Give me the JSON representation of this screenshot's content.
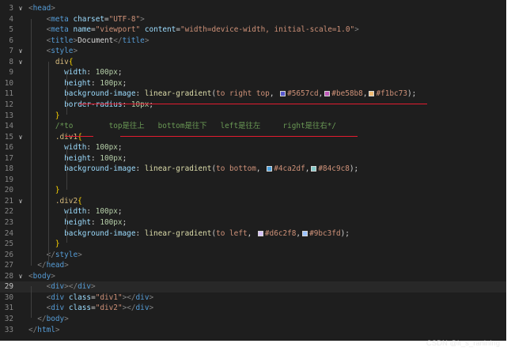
{
  "editor": {
    "lines": [
      {
        "n": "3",
        "fold": "v",
        "segs": [
          [
            "t-br",
            "<"
          ],
          [
            "t-tag",
            "head"
          ],
          [
            "t-br",
            ">"
          ]
        ]
      },
      {
        "n": "4",
        "fold": "",
        "segs": [
          [
            "t-txt",
            "    "
          ],
          [
            "t-br",
            "<"
          ],
          [
            "t-tag",
            "meta"
          ],
          [
            "t-txt",
            " "
          ],
          [
            "t-attr",
            "charset"
          ],
          [
            "t-txt",
            "="
          ],
          [
            "t-str",
            "\"UTF-8\""
          ],
          [
            "t-br",
            ">"
          ]
        ]
      },
      {
        "n": "5",
        "fold": "",
        "segs": [
          [
            "t-txt",
            "    "
          ],
          [
            "t-br",
            "<"
          ],
          [
            "t-tag",
            "meta"
          ],
          [
            "t-txt",
            " "
          ],
          [
            "t-attr",
            "name"
          ],
          [
            "t-txt",
            "="
          ],
          [
            "t-str",
            "\"viewport\""
          ],
          [
            "t-txt",
            " "
          ],
          [
            "t-attr",
            "content"
          ],
          [
            "t-txt",
            "="
          ],
          [
            "t-str",
            "\"width=device-width, initial-scale=1.0\""
          ],
          [
            "t-br",
            ">"
          ]
        ]
      },
      {
        "n": "6",
        "fold": "",
        "segs": [
          [
            "t-txt",
            "    "
          ],
          [
            "t-br",
            "<"
          ],
          [
            "t-tag",
            "title"
          ],
          [
            "t-br",
            ">"
          ],
          [
            "t-txt",
            "Document"
          ],
          [
            "t-br",
            "</"
          ],
          [
            "t-tag",
            "title"
          ],
          [
            "t-br",
            ">"
          ]
        ]
      },
      {
        "n": "7",
        "fold": "v",
        "segs": [
          [
            "t-txt",
            "    "
          ],
          [
            "t-br",
            "<"
          ],
          [
            "t-tag",
            "style"
          ],
          [
            "t-br",
            ">"
          ]
        ]
      },
      {
        "n": "8",
        "fold": "v",
        "segs": [
          [
            "t-txt",
            "      "
          ],
          [
            "t-sel",
            "div"
          ],
          [
            "t-brace",
            "{"
          ]
        ]
      },
      {
        "n": "9",
        "fold": "",
        "segs": [
          [
            "t-txt",
            "        "
          ],
          [
            "t-prop",
            "width"
          ],
          [
            "t-pun",
            ": "
          ],
          [
            "t-num",
            "100px"
          ],
          [
            "t-pun",
            ";"
          ]
        ]
      },
      {
        "n": "10",
        "fold": "",
        "segs": [
          [
            "t-txt",
            "        "
          ],
          [
            "t-prop",
            "height"
          ],
          [
            "t-pun",
            ": "
          ],
          [
            "t-num",
            "100px"
          ],
          [
            "t-pun",
            ";"
          ]
        ]
      },
      {
        "n": "11",
        "fold": "",
        "segs": [
          [
            "t-txt",
            "        "
          ],
          [
            "t-prop",
            "background-image"
          ],
          [
            "t-pun",
            ": "
          ],
          [
            "t-fn",
            "linear-gradient"
          ],
          [
            "t-pun",
            "("
          ],
          [
            "t-val",
            "to right top"
          ],
          [
            "t-pun",
            ", "
          ],
          [
            "sw",
            "#5657cd"
          ],
          [
            "t-val",
            "#5657cd"
          ],
          [
            "t-pun",
            ","
          ],
          [
            "sw",
            "#be58b8"
          ],
          [
            "t-val",
            "#be58b8"
          ],
          [
            "t-pun",
            ","
          ],
          [
            "sw",
            "#f1bc73"
          ],
          [
            "t-val",
            "#f1bc73"
          ],
          [
            "t-pun",
            ");"
          ]
        ]
      },
      {
        "n": "12",
        "fold": "",
        "segs": [
          [
            "t-txt",
            "        "
          ],
          [
            "t-prop",
            "border-radius"
          ],
          [
            "t-pun",
            ": "
          ],
          [
            "t-num",
            "10px"
          ],
          [
            "t-pun",
            ";"
          ]
        ]
      },
      {
        "n": "13",
        "fold": "",
        "segs": [
          [
            "t-txt",
            "      "
          ],
          [
            "t-brace",
            "}"
          ]
        ]
      },
      {
        "n": "14",
        "fold": "",
        "segs": [
          [
            "t-txt",
            "      "
          ],
          [
            "t-cmt",
            "/*to        top是往上   bottom是往下   left是往左     right是往右*/"
          ]
        ]
      },
      {
        "n": "15",
        "fold": "v",
        "segs": [
          [
            "t-txt",
            "      "
          ],
          [
            "t-sel",
            ".div1"
          ],
          [
            "t-brace",
            "{"
          ]
        ]
      },
      {
        "n": "16",
        "fold": "",
        "segs": [
          [
            "t-txt",
            "        "
          ],
          [
            "t-prop",
            "width"
          ],
          [
            "t-pun",
            ": "
          ],
          [
            "t-num",
            "100px"
          ],
          [
            "t-pun",
            ";"
          ]
        ]
      },
      {
        "n": "17",
        "fold": "",
        "segs": [
          [
            "t-txt",
            "        "
          ],
          [
            "t-prop",
            "height"
          ],
          [
            "t-pun",
            ": "
          ],
          [
            "t-num",
            "100px"
          ],
          [
            "t-pun",
            ";"
          ]
        ]
      },
      {
        "n": "18",
        "fold": "",
        "segs": [
          [
            "t-txt",
            "        "
          ],
          [
            "t-prop",
            "background-image"
          ],
          [
            "t-pun",
            ": "
          ],
          [
            "t-fn",
            "linear-gradient"
          ],
          [
            "t-pun",
            "("
          ],
          [
            "t-val",
            "to bottom"
          ],
          [
            "t-pun",
            ", "
          ],
          [
            "sw",
            "#4ca2df"
          ],
          [
            "t-val",
            "#4ca2df"
          ],
          [
            "t-pun",
            ","
          ],
          [
            "sw",
            "#84c9c8"
          ],
          [
            "t-val",
            "#84c9c8"
          ],
          [
            "t-pun",
            ");"
          ]
        ]
      },
      {
        "n": "19",
        "fold": "",
        "segs": []
      },
      {
        "n": "20",
        "fold": "",
        "segs": [
          [
            "t-txt",
            "      "
          ],
          [
            "t-brace",
            "}"
          ]
        ]
      },
      {
        "n": "21",
        "fold": "v",
        "segs": [
          [
            "t-txt",
            "      "
          ],
          [
            "t-sel",
            ".div2"
          ],
          [
            "t-brace",
            "{"
          ]
        ]
      },
      {
        "n": "22",
        "fold": "",
        "segs": [
          [
            "t-txt",
            "        "
          ],
          [
            "t-prop",
            "width"
          ],
          [
            "t-pun",
            ": "
          ],
          [
            "t-num",
            "100px"
          ],
          [
            "t-pun",
            ";"
          ]
        ]
      },
      {
        "n": "23",
        "fold": "",
        "segs": [
          [
            "t-txt",
            "        "
          ],
          [
            "t-prop",
            "height"
          ],
          [
            "t-pun",
            ": "
          ],
          [
            "t-num",
            "100px"
          ],
          [
            "t-pun",
            ";"
          ]
        ]
      },
      {
        "n": "24",
        "fold": "",
        "segs": [
          [
            "t-txt",
            "        "
          ],
          [
            "t-prop",
            "background-image"
          ],
          [
            "t-pun",
            ": "
          ],
          [
            "t-fn",
            "linear-gradient"
          ],
          [
            "t-pun",
            "("
          ],
          [
            "t-val",
            "to left"
          ],
          [
            "t-pun",
            ", "
          ],
          [
            "sw",
            "#d6c2f8"
          ],
          [
            "t-val",
            "#d6c2f8"
          ],
          [
            "t-pun",
            ","
          ],
          [
            "sw",
            "#9bc3fd"
          ],
          [
            "t-val",
            "#9bc3fd"
          ],
          [
            "t-pun",
            ");"
          ]
        ]
      },
      {
        "n": "25",
        "fold": "",
        "segs": [
          [
            "t-txt",
            "      "
          ],
          [
            "t-brace",
            "}"
          ]
        ]
      },
      {
        "n": "26",
        "fold": "",
        "segs": [
          [
            "t-txt",
            "    "
          ],
          [
            "t-br",
            "</"
          ],
          [
            "t-tag",
            "style"
          ],
          [
            "t-br",
            ">"
          ]
        ]
      },
      {
        "n": "27",
        "fold": "",
        "segs": [
          [
            "t-br",
            "  </"
          ],
          [
            "t-tag",
            "head"
          ],
          [
            "t-br",
            ">"
          ]
        ]
      },
      {
        "n": "28",
        "fold": "v",
        "segs": [
          [
            "t-br",
            "<"
          ],
          [
            "t-tag",
            "body"
          ],
          [
            "t-br",
            ">"
          ]
        ]
      },
      {
        "n": "29",
        "fold": "",
        "active": true,
        "segs": [
          [
            "t-txt",
            "    "
          ],
          [
            "t-br",
            "<"
          ],
          [
            "t-tag",
            "div"
          ],
          [
            "t-br",
            "></"
          ],
          [
            "t-tag",
            "div"
          ],
          [
            "t-br",
            ">"
          ]
        ]
      },
      {
        "n": "30",
        "fold": "",
        "segs": [
          [
            "t-txt",
            "    "
          ],
          [
            "t-br",
            "<"
          ],
          [
            "t-tag",
            "div"
          ],
          [
            "t-txt",
            " "
          ],
          [
            "t-attr",
            "class"
          ],
          [
            "t-txt",
            "="
          ],
          [
            "t-str",
            "\"div1\""
          ],
          [
            "t-br",
            "></"
          ],
          [
            "t-tag",
            "div"
          ],
          [
            "t-br",
            ">"
          ]
        ]
      },
      {
        "n": "31",
        "fold": "",
        "segs": [
          [
            "t-txt",
            "    "
          ],
          [
            "t-br",
            "<"
          ],
          [
            "t-tag",
            "div"
          ],
          [
            "t-txt",
            " "
          ],
          [
            "t-attr",
            "class"
          ],
          [
            "t-txt",
            "="
          ],
          [
            "t-str",
            "\"div2\""
          ],
          [
            "t-br",
            "></"
          ],
          [
            "t-tag",
            "div"
          ],
          [
            "t-br",
            ">"
          ]
        ]
      },
      {
        "n": "32",
        "fold": "",
        "segs": [
          [
            "t-br",
            "  </"
          ],
          [
            "t-tag",
            "body"
          ],
          [
            "t-br",
            ">"
          ]
        ]
      },
      {
        "n": "33",
        "fold": "",
        "segs": [
          [
            "t-br",
            "</"
          ],
          [
            "t-tag",
            "html"
          ],
          [
            "t-br",
            ">"
          ]
        ]
      }
    ]
  },
  "watermark": "CSDN @it_s_ranining",
  "colors": {
    "background": "#1e1e1e",
    "annotation": "#e41b2f"
  }
}
